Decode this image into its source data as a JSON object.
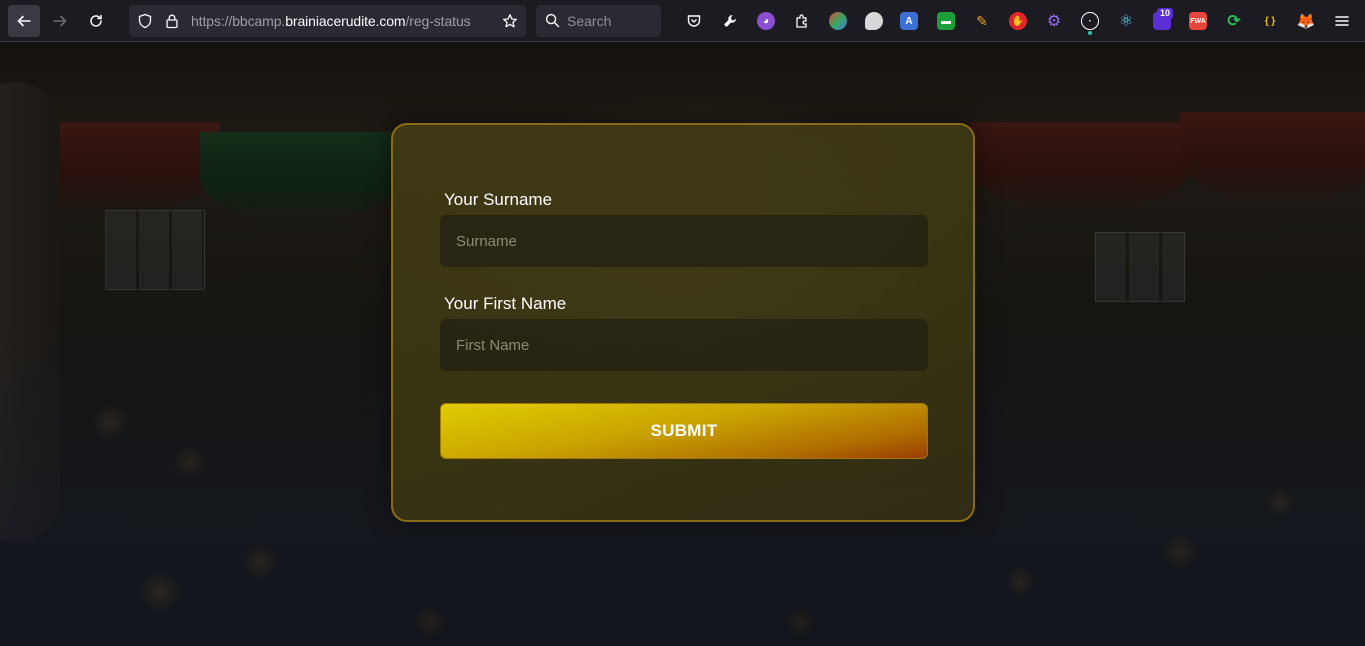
{
  "browser": {
    "url_prefix": "https://bbcamp.",
    "url_host": "brainiacerudite.com",
    "url_path": "/reg-status",
    "search_placeholder": "Search",
    "badge_count": "10",
    "ext_fwa_label": "FWA",
    "ext_json_label": "{ }"
  },
  "form": {
    "surname_label": "Your Surname",
    "surname_placeholder": "Surname",
    "firstname_label": "Your First Name",
    "firstname_placeholder": "First Name",
    "submit_label": "SUBMIT"
  },
  "colors": {
    "accent_gold": "#d4b400",
    "card_border": "#8a6a12",
    "browser_bg": "#1c1b22"
  }
}
